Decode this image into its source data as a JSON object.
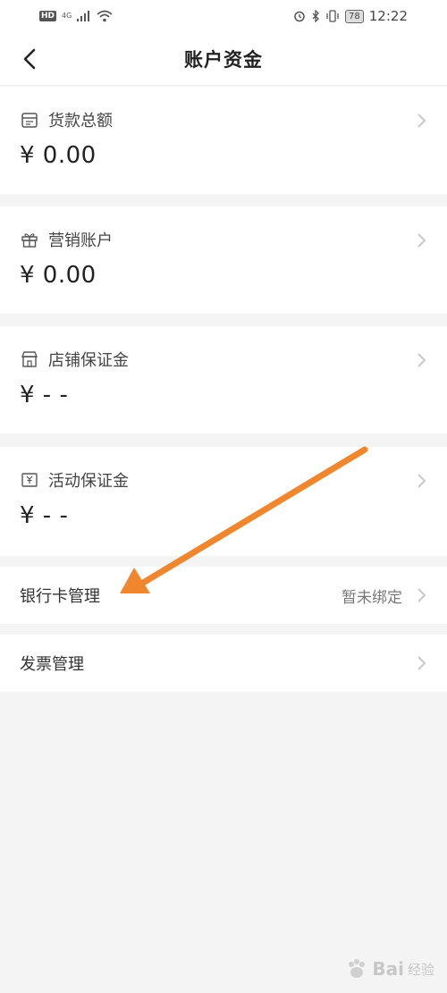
{
  "status_bar": {
    "hd": "HD",
    "network": "4G",
    "battery": "78",
    "time": "12:22"
  },
  "nav": {
    "title": "账户资金"
  },
  "cards": [
    {
      "label": "货款总额",
      "value": "¥ 0.00",
      "icon": "wallet-icon"
    },
    {
      "label": "营销账户",
      "value": "¥ 0.00",
      "icon": "gift-icon"
    },
    {
      "label": "店铺保证金",
      "value": "¥ - -",
      "icon": "store-icon"
    },
    {
      "label": "活动保证金",
      "value": "¥ - -",
      "icon": "ticket-icon"
    }
  ],
  "rows": [
    {
      "label": "银行卡管理",
      "status": "暂未绑定"
    },
    {
      "label": "发票管理",
      "status": ""
    }
  ],
  "annotation": {
    "arrow_color": "#f0872e"
  },
  "watermark": {
    "brand": "Bai",
    "suffix": "经验"
  }
}
